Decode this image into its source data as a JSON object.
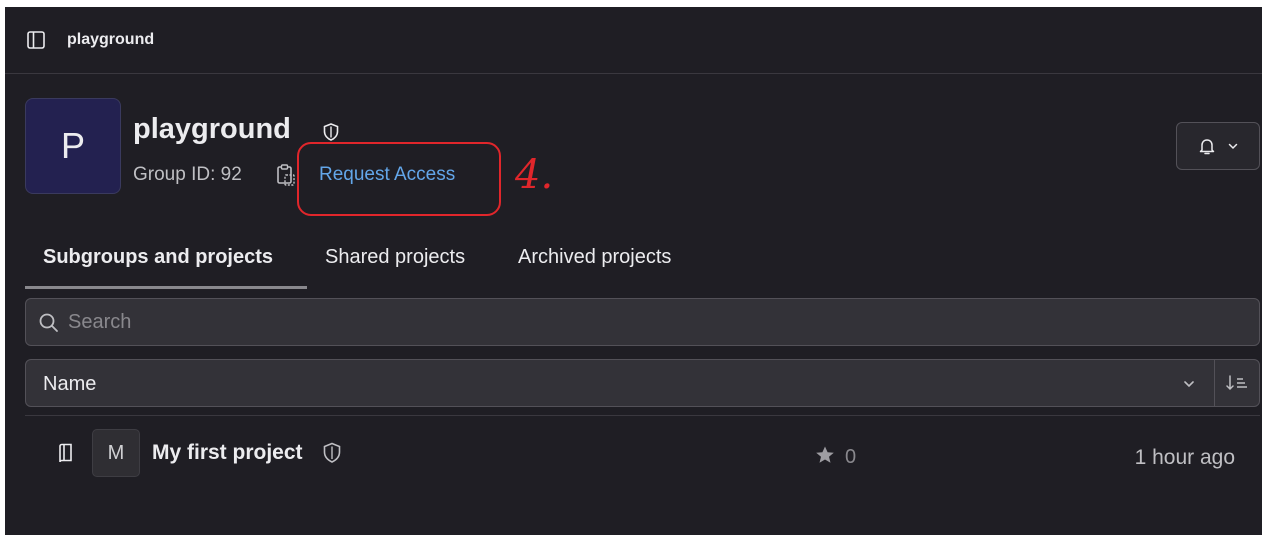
{
  "breadcrumb": {
    "label": "playground"
  },
  "group": {
    "avatar_letter": "P",
    "name": "playground",
    "id_label": "Group ID: 92",
    "request_access_label": "Request Access"
  },
  "annotation": {
    "number": "4."
  },
  "tabs": [
    {
      "label": "Subgroups and projects",
      "active": true
    },
    {
      "label": "Shared projects",
      "active": false
    },
    {
      "label": "Archived projects",
      "active": false
    }
  ],
  "search": {
    "placeholder": "Search",
    "value": ""
  },
  "sort": {
    "selected": "Name"
  },
  "projects": [
    {
      "avatar_letter": "M",
      "name": "My first project",
      "stars": "0",
      "updated": "1 hour ago"
    }
  ],
  "colors": {
    "background": "#1f1e24",
    "link": "#63a6e9",
    "annotation": "#e0262b",
    "avatar_bg": "#232150"
  },
  "icons": {
    "sidebar_toggle": "sidebar-toggle-icon",
    "visibility": "shield-icon",
    "copy": "clipboard-icon",
    "notification": "bell-icon",
    "search": "search-icon",
    "sort_direction": "sort-ascending-icon",
    "project_type": "book-icon",
    "star": "star-icon"
  }
}
